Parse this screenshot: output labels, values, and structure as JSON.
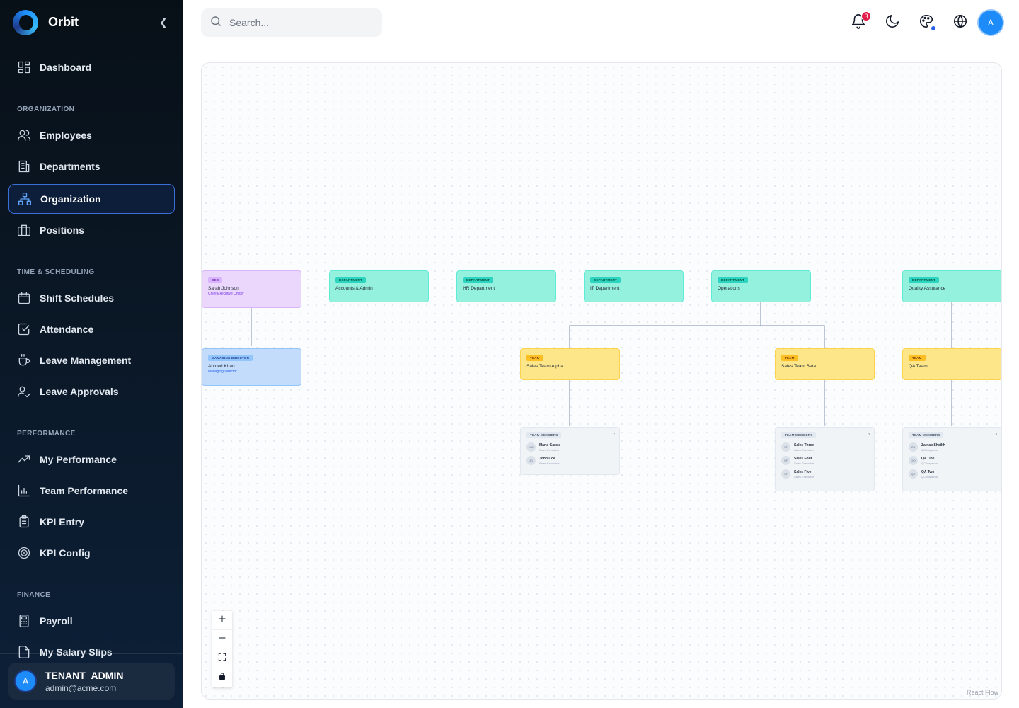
{
  "app": {
    "name": "Orbit",
    "collapse_icon": "chevron-left-icon"
  },
  "sidebar": {
    "top_item": {
      "label": "Dashboard",
      "icon": "dashboard-grid-icon"
    },
    "sections": [
      {
        "label": "ORGANIZATION",
        "items": [
          {
            "label": "Employees",
            "icon": "users-icon"
          },
          {
            "label": "Departments",
            "icon": "building-icon"
          },
          {
            "label": "Organization",
            "icon": "org-chart-icon",
            "active": true
          },
          {
            "label": "Positions",
            "icon": "briefcase-icon"
          }
        ]
      },
      {
        "label": "TIME & SCHEDULING",
        "items": [
          {
            "label": "Shift Schedules",
            "icon": "calendar-icon"
          },
          {
            "label": "Attendance",
            "icon": "check-square-icon"
          },
          {
            "label": "Leave Management",
            "icon": "coffee-icon"
          },
          {
            "label": "Leave Approvals",
            "icon": "user-check-icon"
          }
        ]
      },
      {
        "label": "PERFORMANCE",
        "items": [
          {
            "label": "My Performance",
            "icon": "trending-up-icon"
          },
          {
            "label": "Team Performance",
            "icon": "bar-chart-icon"
          },
          {
            "label": "KPI Entry",
            "icon": "clipboard-icon"
          },
          {
            "label": "KPI Config",
            "icon": "target-icon"
          }
        ]
      },
      {
        "label": "FINANCE",
        "items": [
          {
            "label": "Payroll",
            "icon": "calculator-icon"
          },
          {
            "label": "My Salary Slips",
            "icon": "file-icon"
          }
        ]
      }
    ],
    "user": {
      "avatar": "A",
      "role": "TENANT_ADMIN",
      "email": "admin@acme.com"
    }
  },
  "header": {
    "search_placeholder": "Search...",
    "notification_count": "3",
    "avatar": "A"
  },
  "org_chart": {
    "ceo": {
      "tag": "CEO",
      "name": "Sarah Johnson",
      "role": "Chief Executive Officer"
    },
    "md": {
      "tag": "MANAGING DIRECTOR",
      "name": "Ahmed Khan",
      "role": "Managing Director"
    },
    "departments": [
      {
        "tag": "DEPARTMENT",
        "name": "Accounts & Admin"
      },
      {
        "tag": "DEPARTMENT",
        "name": "HR Department"
      },
      {
        "tag": "DEPARTMENT",
        "name": "IT Department"
      },
      {
        "tag": "DEPARTMENT",
        "name": "Operations"
      },
      {
        "tag": "DEPARTMENT",
        "name": "Quality Assurance"
      }
    ],
    "teams": [
      {
        "tag": "TEAM",
        "name": "Sales Team Alpha"
      },
      {
        "tag": "TEAM",
        "name": "Sales Team Beta"
      },
      {
        "tag": "TEAM",
        "name": "QA Team"
      }
    ],
    "member_groups": [
      {
        "tag": "TEAM MEMBERS",
        "count": "2",
        "members": [
          {
            "initials": "MG",
            "name": "Maria Garcia",
            "role": "Sales Executive"
          },
          {
            "initials": "JD",
            "name": "John Doe",
            "role": "Sales Executive"
          }
        ]
      },
      {
        "tag": "TEAM MEMBERS",
        "count": "3",
        "members": [
          {
            "initials": "ST",
            "name": "Sales Three",
            "role": "Sales Executive"
          },
          {
            "initials": "SF",
            "name": "Sales Four",
            "role": "Sales Executive"
          },
          {
            "initials": "SF",
            "name": "Sales Five",
            "role": "Sales Executive"
          }
        ]
      },
      {
        "tag": "TEAM MEMBERS",
        "count": "3",
        "members": [
          {
            "initials": "ZS",
            "name": "Zainab Sheikh",
            "role": "QC Inspector"
          },
          {
            "initials": "QO",
            "name": "QA One",
            "role": "QC Inspector"
          },
          {
            "initials": "QT",
            "name": "QA Two",
            "role": "QC Inspector"
          }
        ]
      }
    ],
    "attribution": "React Flow"
  },
  "colors": {
    "accent": "#1d8cf8",
    "sidebar_bg": "#0b1a2b",
    "active_border": "#3b6fd8",
    "badge": "#e11d48"
  }
}
